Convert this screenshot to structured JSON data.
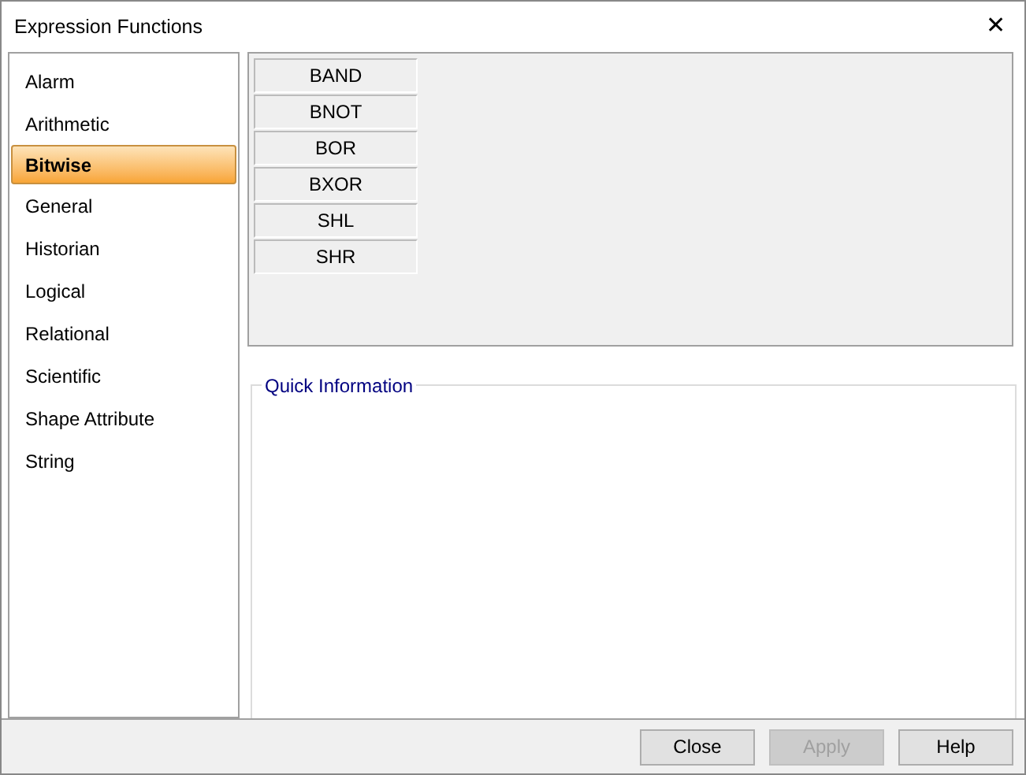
{
  "window": {
    "title": "Expression Functions",
    "close": "✕"
  },
  "categories": [
    {
      "label": "Alarm",
      "selected": false
    },
    {
      "label": "Arithmetic",
      "selected": false
    },
    {
      "label": "Bitwise",
      "selected": true
    },
    {
      "label": "General",
      "selected": false
    },
    {
      "label": "Historian",
      "selected": false
    },
    {
      "label": "Logical",
      "selected": false
    },
    {
      "label": "Relational",
      "selected": false
    },
    {
      "label": "Scientific",
      "selected": false
    },
    {
      "label": "Shape Attribute",
      "selected": false
    },
    {
      "label": "String",
      "selected": false
    }
  ],
  "functions": [
    "BAND",
    "BNOT",
    "BOR",
    "BXOR",
    "SHL",
    "SHR"
  ],
  "quick_information": {
    "title": "Quick Information"
  },
  "buttons": [
    {
      "label": "Close",
      "disabled": false
    },
    {
      "label": "Apply",
      "disabled": true
    },
    {
      "label": "Help",
      "disabled": false
    }
  ]
}
